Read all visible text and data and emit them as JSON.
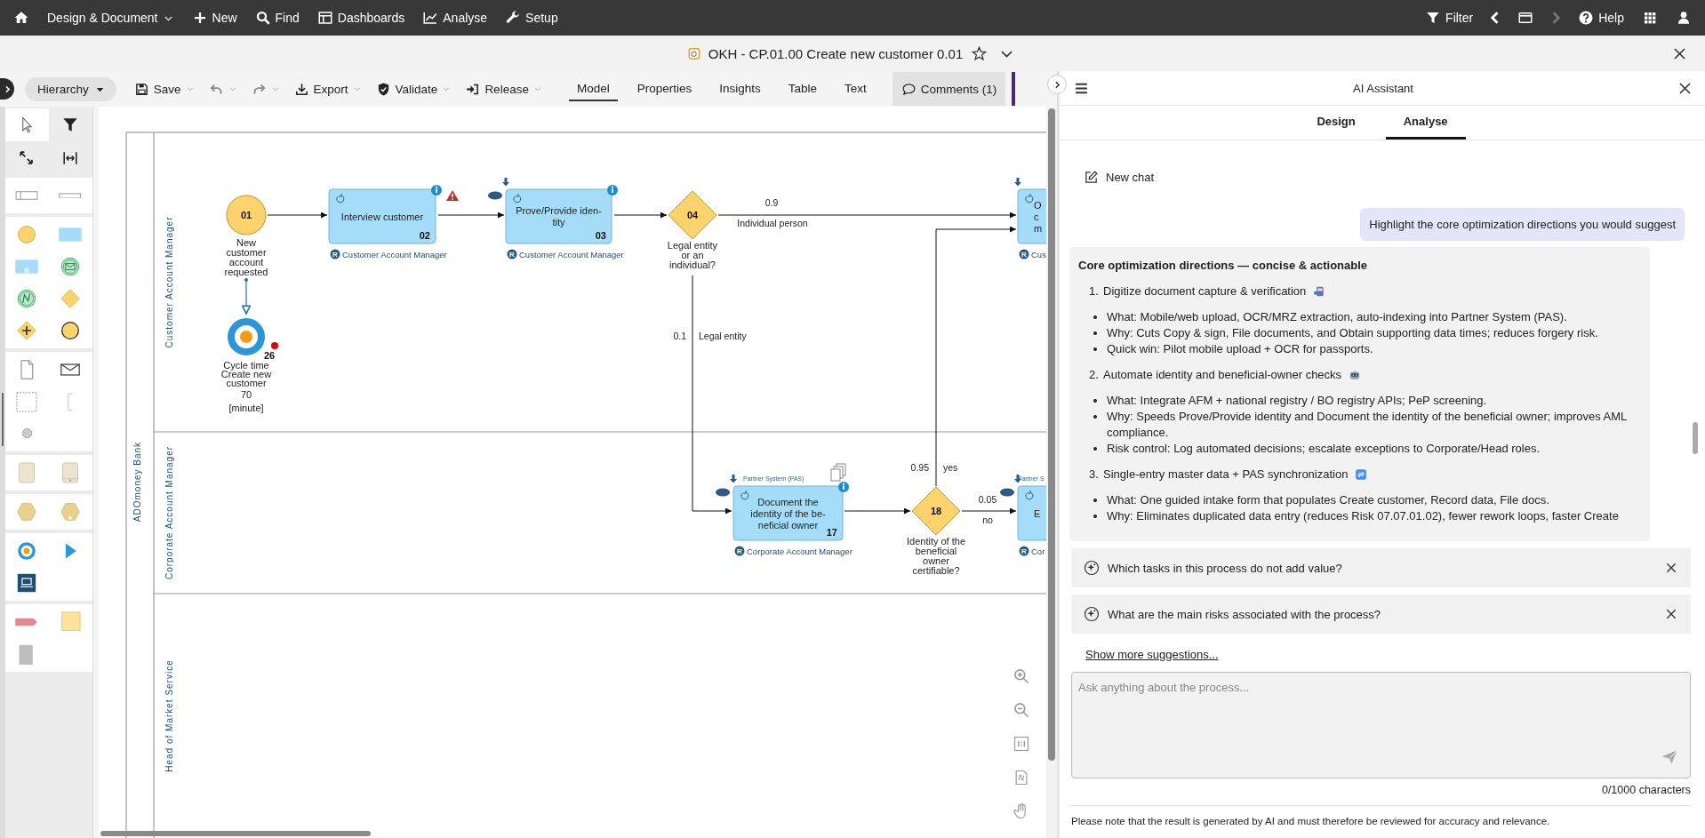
{
  "nav": {
    "items": [
      {
        "kind": "home"
      },
      {
        "kind": "dropdown",
        "label": "Design & Document"
      },
      {
        "kind": "new",
        "label": "New"
      },
      {
        "kind": "find",
        "label": "Find"
      },
      {
        "kind": "dashboards",
        "label": "Dashboards"
      },
      {
        "kind": "analyse",
        "label": "Analyse"
      },
      {
        "kind": "setup",
        "label": "Setup"
      }
    ],
    "right": [
      {
        "kind": "filter",
        "label": "Filter",
        "disabled": false
      },
      {
        "kind": "back",
        "disabled": false
      },
      {
        "kind": "windows",
        "disabled": false
      },
      {
        "kind": "forward",
        "disabled": true
      },
      {
        "kind": "help",
        "label": "Help",
        "disabled": false
      },
      {
        "kind": "apps",
        "disabled": false
      },
      {
        "kind": "user",
        "disabled": false
      }
    ]
  },
  "document": {
    "title": "OKH - CP.01.00 Create new customer 0.01",
    "favorite": false
  },
  "toolbar": {
    "hierarchy": "Hierarchy",
    "actions": [
      {
        "kind": "save",
        "label": "Save"
      },
      {
        "kind": "undo"
      },
      {
        "kind": "redo"
      },
      {
        "kind": "export",
        "label": "Export"
      },
      {
        "kind": "validate",
        "label": "Validate"
      },
      {
        "kind": "release",
        "label": "Release"
      }
    ],
    "views": [
      {
        "label": "Model",
        "selected": true
      },
      {
        "label": "Properties",
        "selected": false
      },
      {
        "label": "Insights",
        "selected": false
      },
      {
        "label": "Table",
        "selected": false
      },
      {
        "label": "Text",
        "selected": false
      }
    ],
    "comments": "Comments (1)"
  },
  "palette": {
    "tools": [
      {
        "kind": "pointer",
        "selected": true
      },
      {
        "kind": "filter",
        "selected": false
      },
      {
        "kind": "resize",
        "selected": false
      },
      {
        "kind": "fit-width",
        "selected": false
      }
    ],
    "groups": [
      {
        "items": [
          {
            "kind": "pool"
          },
          {
            "kind": "lane"
          }
        ]
      },
      {
        "items": [
          {
            "kind": "start-event"
          },
          {
            "kind": "task"
          },
          {
            "kind": "subprocess"
          },
          {
            "kind": "message-event"
          },
          {
            "kind": "signal-event"
          },
          {
            "kind": "gateway"
          },
          {
            "kind": "parallel-gateway"
          },
          {
            "kind": "end-event"
          }
        ]
      },
      {
        "items": [
          {
            "kind": "document"
          },
          {
            "kind": "message"
          },
          {
            "kind": "group"
          },
          {
            "kind": "annotation"
          },
          {
            "kind": "point"
          }
        ]
      },
      {
        "items": [
          {
            "kind": "data-store"
          },
          {
            "kind": "data-store-marked"
          }
        ]
      },
      {
        "items": [
          {
            "kind": "hexagon"
          },
          {
            "kind": "hexagon-marked"
          }
        ]
      },
      {
        "items": [
          {
            "kind": "target"
          },
          {
            "kind": "play"
          },
          {
            "kind": "system"
          }
        ]
      },
      {
        "items": [
          {
            "kind": "tag"
          },
          {
            "kind": "note"
          },
          {
            "kind": "block"
          }
        ]
      }
    ]
  },
  "diagram": {
    "pool": "ADOmoney Bank",
    "lanes": [
      {
        "label": "Customer Account Manager"
      },
      {
        "label": "Corporate Account Manager"
      },
      {
        "label": "Head of Market Service"
      }
    ],
    "nodes": [
      {
        "kind": "start_event",
        "number": "01",
        "label": [
          "New",
          "customer",
          "account",
          "requested"
        ]
      },
      {
        "kind": "kpi_event",
        "number": "26",
        "alert": true,
        "label": [
          "Cycle time",
          "Create new",
          "customer"
        ],
        "value": "70",
        "unit": "[minute]"
      },
      {
        "kind": "task",
        "number": "02",
        "text": [
          "Interview customer"
        ],
        "role_marker": "R",
        "role": "Customer Account Manager",
        "info": true,
        "warning": true
      },
      {
        "kind": "task",
        "number": "03",
        "text": [
          "Prove/Provide iden-",
          "tity"
        ],
        "role_marker": "R",
        "role": "Customer Account Manager",
        "info": true,
        "arrow_marker": true,
        "ellipse_marker": true
      },
      {
        "kind": "gateway",
        "number": "04",
        "label": [
          "Legal entity",
          "or an",
          "individual?"
        ]
      },
      {
        "kind": "task",
        "text": [
          "O",
          "c",
          "m"
        ],
        "role_marker": "R",
        "role": "Cus",
        "arrow_marker": true
      },
      {
        "kind": "task",
        "number": "17",
        "system": "Partner System (PAS)",
        "text": [
          "Document the",
          "identity of the be-",
          "neficial owner"
        ],
        "role_marker": "R",
        "role": "Corporate Account Manager",
        "info": true,
        "arrow_marker": true,
        "ellipse_marker": true,
        "documents": true
      },
      {
        "kind": "gateway",
        "number": "18",
        "label": [
          "Identity of the",
          "beneficial",
          "owner",
          "certifiable?"
        ]
      },
      {
        "kind": "task",
        "system": "Partner S",
        "text": [
          "E"
        ],
        "role_marker": "R",
        "role": "Cor",
        "arrow_marker": true,
        "ellipse_marker": true
      }
    ],
    "edges": [
      {
        "kind": "flow"
      },
      {
        "kind": "flow"
      },
      {
        "kind": "flow"
      },
      {
        "kind": "flow",
        "probability": "0.9",
        "condition": "Individual person"
      },
      {
        "kind": "flow",
        "probability": "0.1",
        "condition": "Legal entity"
      },
      {
        "kind": "flow"
      },
      {
        "kind": "flow",
        "probability": "0.95",
        "condition": "yes"
      },
      {
        "kind": "flow",
        "probability": "0.05",
        "condition": "no"
      },
      {
        "kind": "link"
      }
    ],
    "zoom_tools": [
      {
        "kind": "zoom-in"
      },
      {
        "kind": "zoom-out"
      },
      {
        "kind": "actual-size"
      },
      {
        "kind": "fit-page"
      },
      {
        "kind": "pan"
      }
    ]
  },
  "assistant": {
    "title": "AI Assistant",
    "tabs": [
      {
        "label": "Design",
        "selected": false
      },
      {
        "label": "Analyse",
        "selected": true
      }
    ],
    "new_chat": "New chat",
    "question": "Highlight the core optimization directions you would suggest",
    "answer": {
      "heading": "Core optimization directions — concise & actionable",
      "sections": [
        {
          "number": "1.",
          "title": "Digitize document capture & verification",
          "bullets": [
            "What: Mobile/web upload, OCR/MRZ extraction, auto-indexing into Partner System (PAS).",
            "Why: Cuts Copy & sign, File documents, and Obtain supporting data times; reduces forgery risk.",
            "Quick win: Pilot mobile upload + OCR for passports."
          ]
        },
        {
          "number": "2.",
          "title": "Automate identity and beneficial-owner checks",
          "bullets": [
            "What: Integrate AFM + national registry / BO registry APIs; PeP screening.",
            "Why: Speeds Prove/Provide identity and Document the identity of the beneficial owner; improves AML compliance.",
            "Risk control: Log automated decisions; escalate exceptions to Corporate/Head roles."
          ]
        },
        {
          "number": "3.",
          "title": "Single-entry master data + PAS synchronization",
          "bullets": [
            "What: One guided intake form that populates Create customer, Record data, File docs.",
            "Why: Eliminates duplicated data entry (reduces Risk 07.07.01.02), fewer rework loops, faster Create"
          ]
        }
      ]
    },
    "suggestions": [
      "Which tasks in this process do not add value?",
      "What are the main risks associated with the process?"
    ],
    "show_more": "Show more suggestions...",
    "input": {
      "placeholder": "Ask anything about the process..."
    },
    "counter": "0/1000 characters",
    "disclaimer": "Please note that the result is generated by AI and must therefore be reviewed for accuracy and relevance."
  }
}
